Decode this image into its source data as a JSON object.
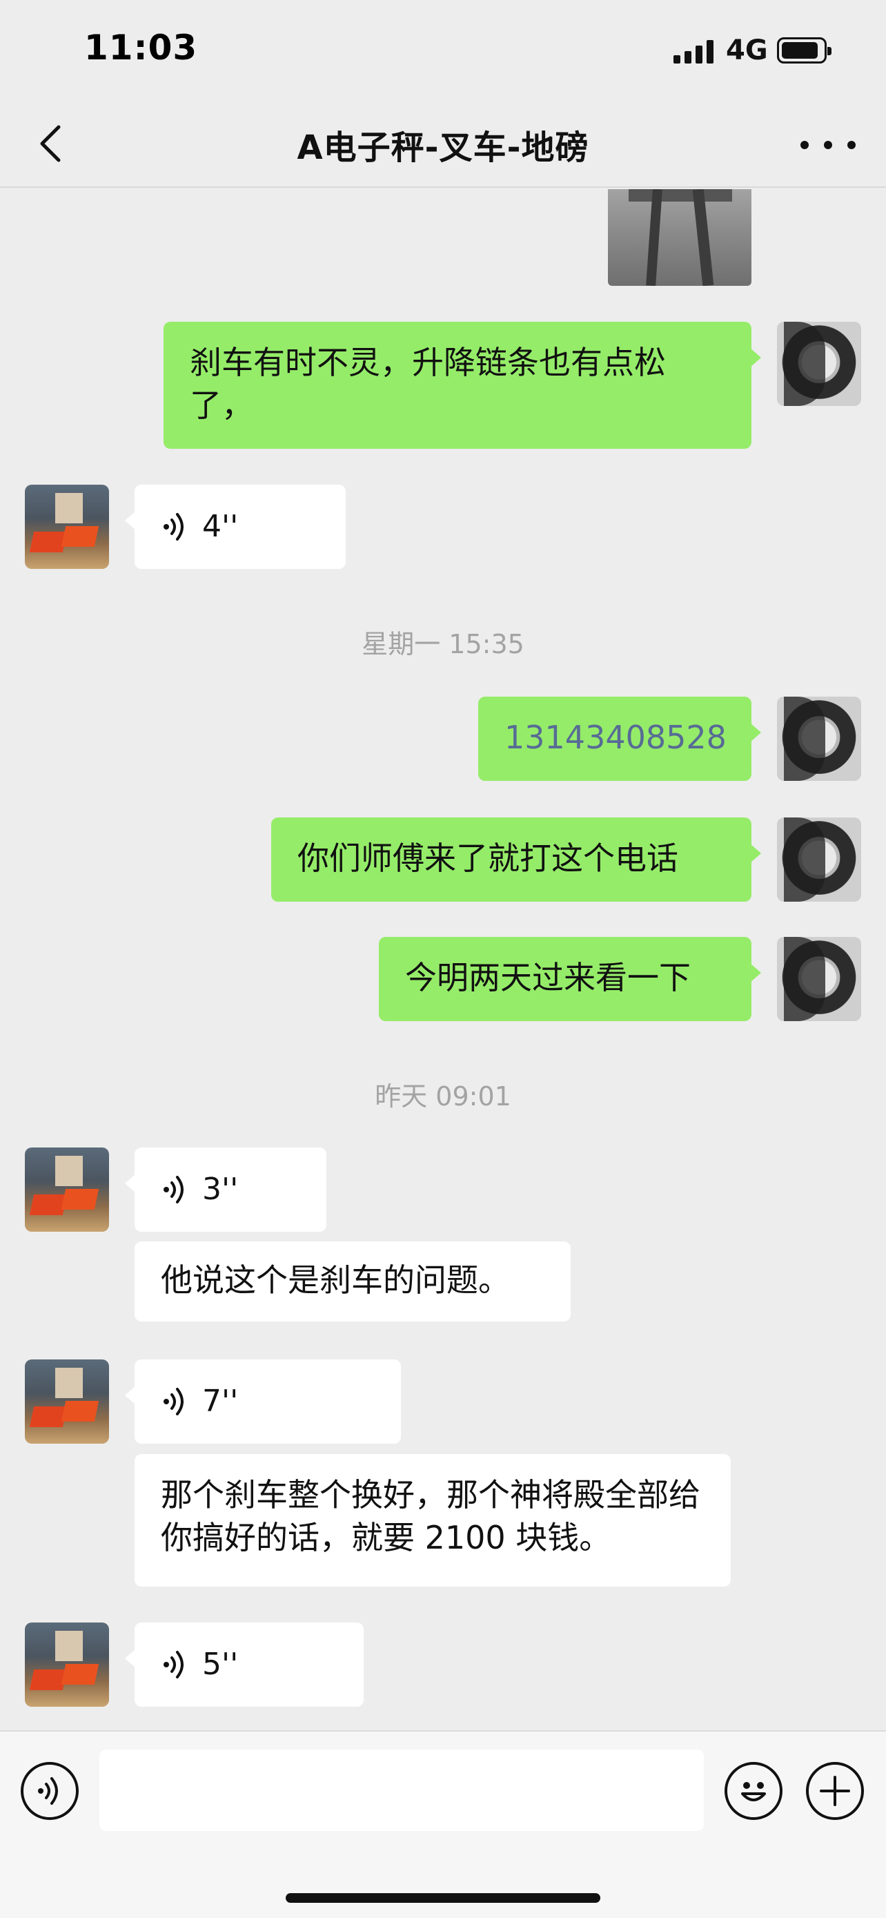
{
  "status": {
    "time": "11:03",
    "network": "4G"
  },
  "nav": {
    "title": "A电子秤-叉车-地磅"
  },
  "messages": {
    "m1": "刹车有时不灵，升降链条也有点松了，",
    "v1": "4''",
    "ts1": "星期一 15:35",
    "m2": "13143408528",
    "m3": "你们师傅来了就打这个电话",
    "m4": "今明两天过来看一下",
    "ts2": "昨天 09:01",
    "v2": "3''",
    "m5": "他说这个是刹车的问题。",
    "v3": "7''",
    "m6": "那个刹车整个换好，那个神将殿全部给你搞好的话，就要 2100 块钱。",
    "v4": "5''"
  },
  "icons": {
    "back": "chevron-left-icon",
    "more": "more-icon",
    "voice": "voice-icon",
    "voice_input": "voice-input-icon",
    "emoji": "emoji-icon",
    "plus": "plus-icon"
  },
  "colors": {
    "my_bubble": "#95ec69",
    "their_bubble": "#ffffff",
    "background": "#ededed",
    "link": "#576b95"
  }
}
